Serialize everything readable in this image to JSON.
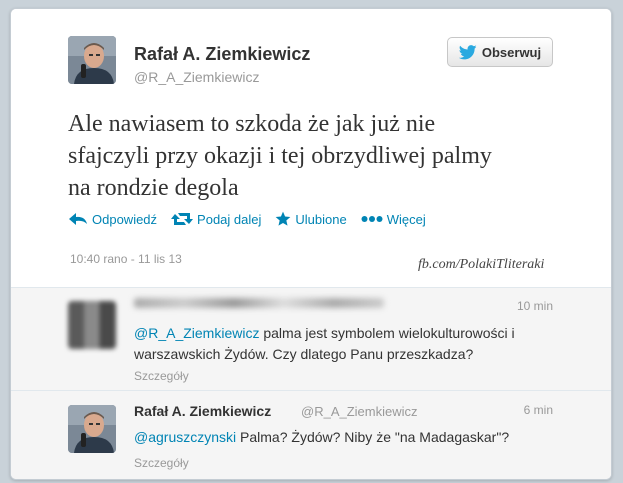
{
  "tweet": {
    "author_name": "Rafał A. Ziemkiewicz",
    "author_handle": "@R_A_Ziemkiewicz",
    "follow_label": "Obserwuj",
    "text_line1": "Ale nawiasem to szkoda że jak już nie",
    "text_line2": "sfajczyli przy okazji i tej obrzydliwej palmy",
    "text_line3": "na rondzie degola",
    "actions": {
      "reply": "Odpowiedź",
      "retweet": "Podaj dalej",
      "favorite": "Ulubione",
      "more": "Więcej"
    },
    "timestamp": "10:40 rano - 11 lis 13"
  },
  "watermark": "fb.com/PolakiTliteraki",
  "replies": [
    {
      "time": "10 min",
      "mention": "@R_A_Ziemkiewicz",
      "text_rest": " palma jest symbolem wielokulturowości i",
      "text_line2": "warszawskich Żydów. Czy dlatego Panu przeszkadza?",
      "details": "Szczegóły"
    },
    {
      "name": "Rafał A. Ziemkiewicz",
      "handle": "@R_A_Ziemkiewicz",
      "time": "6 min",
      "mention": "@agruszczynski",
      "text_rest": " Palma? Żydów? Niby że \"na Madagaskar\"?",
      "details": "Szczegóły"
    }
  ],
  "colors": {
    "link": "#0084b4",
    "muted": "#999999",
    "text": "#333333",
    "twitter_bird": "#2aa9e0"
  },
  "icons": {
    "follow": "twitter-bird-icon",
    "reply": "reply-arrow-icon",
    "retweet": "retweet-icon",
    "favorite": "star-icon",
    "more": "dots-icon"
  }
}
